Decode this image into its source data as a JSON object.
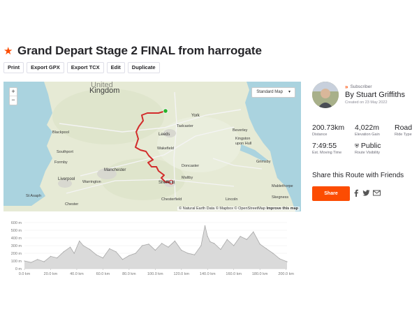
{
  "route": {
    "title": "Grand Depart Stage 2 FINAL from harrogate"
  },
  "actions": [
    "Print",
    "Export GPX",
    "Export TCX",
    "Edit",
    "Duplicate"
  ],
  "map": {
    "type_label": "Standard Map",
    "zoom_in": "+",
    "zoom_out": "−",
    "region_label": "Kingdom",
    "region_label_partial": "United",
    "attribution": "© Natural Earth Data © Mapbox © OpenStreetMap",
    "improve_link": "Improve this map",
    "places": {
      "york": "York",
      "tadcaster": "Tadcaster",
      "leeds": "Leeds",
      "beverley": "Beverley",
      "kingston": "Kingston",
      "upon_hull": "upon Hull",
      "blackpool": "Blackpool",
      "wakefield": "Wakefield",
      "southport": "Southport",
      "formby": "Formby",
      "manchester": "Manchester",
      "doncaster": "Doncaster",
      "grimsby": "Grimsby",
      "liverpool": "Liverpool",
      "warrington": "Warrington",
      "maltby": "Maltby",
      "sheffield": "Sheffield",
      "mablethorpe": "Mablethorpe",
      "skegness": "Skegness",
      "st_asaph": "St Asaph",
      "chester": "Chester",
      "chesterfield": "Chesterfield",
      "lincoln": "Lincoln"
    },
    "colors": {
      "land": "#e6ead5",
      "sea": "#aad3df",
      "route": "#d22c2c",
      "start": "#27b22b"
    }
  },
  "owner": {
    "subscriber_label": "Subscriber",
    "name": "By Stuart Griffiths",
    "created": "Created on 23 May 2022"
  },
  "stats": {
    "distance": {
      "value": "200.73km",
      "label": "Distance"
    },
    "elevation": {
      "value": "4,022m",
      "label": "Elevation Gain"
    },
    "ride_type": {
      "value": "Road",
      "label": "Ride Type"
    },
    "moving_time": {
      "value": "7:49:55",
      "label": "Est. Moving Time"
    },
    "visibility": {
      "value": "Public",
      "label": "Route Visibility"
    }
  },
  "share": {
    "title": "Share this Route with Friends",
    "button": "Share",
    "icons": [
      "facebook-icon",
      "twitter-icon",
      "email-icon"
    ]
  },
  "chart_data": {
    "type": "area",
    "title": "",
    "xlabel": "",
    "ylabel": "",
    "y_ticks": [
      "0 m",
      "100 m",
      "200 m",
      "300 m",
      "400 m",
      "500 m",
      "600 m"
    ],
    "x_ticks": [
      "0.0 km",
      "20.0 km",
      "40.0 km",
      "60.0 km",
      "80.0 km",
      "100.0 km",
      "120.0 km",
      "140.0 km",
      "160.0 km",
      "180.0 km",
      "200.0 km"
    ],
    "xlim": [
      0,
      200.73
    ],
    "ylim": [
      0,
      600
    ],
    "x": [
      0,
      5,
      10,
      15,
      20,
      25,
      30,
      35,
      38,
      42,
      45,
      50,
      55,
      60,
      65,
      70,
      75,
      80,
      85,
      90,
      95,
      100,
      105,
      110,
      115,
      120,
      125,
      130,
      135,
      138,
      140,
      142,
      145,
      150,
      155,
      160,
      165,
      170,
      175,
      180,
      185,
      190,
      195,
      200.73
    ],
    "y": [
      100,
      80,
      120,
      90,
      160,
      140,
      220,
      280,
      200,
      360,
      300,
      250,
      180,
      140,
      260,
      220,
      120,
      170,
      200,
      300,
      320,
      240,
      330,
      280,
      360,
      240,
      200,
      180,
      300,
      560,
      420,
      350,
      330,
      250,
      380,
      300,
      420,
      380,
      480,
      320,
      260,
      200,
      130,
      90
    ],
    "colors": {
      "fill": "#dadada",
      "line": "#a7a7a7"
    }
  }
}
